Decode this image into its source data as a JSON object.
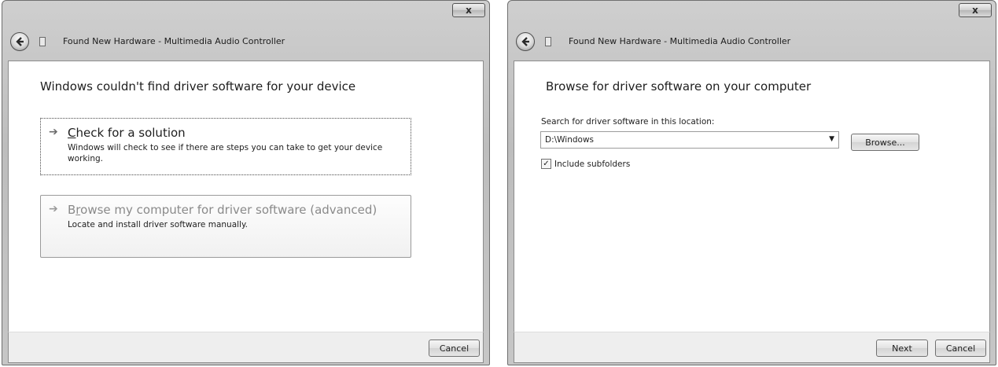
{
  "left_dialog": {
    "close_glyph": "x",
    "title": "Found New Hardware - Multimedia Audio Controller",
    "heading": "Windows couldn't find driver software for your device",
    "options": [
      {
        "title_accel": "C",
        "title_rest": "heck for a solution",
        "description": "Windows will check to see if there are steps you can take to get your device working."
      },
      {
        "title_pre": "B",
        "title_accel": "r",
        "title_rest": "owse my computer for driver software (advanced)",
        "description": "Locate and install driver software manually."
      }
    ],
    "cancel_label": "Cancel"
  },
  "right_dialog": {
    "close_glyph": "x",
    "title": "Found New Hardware - Multimedia Audio Controller",
    "heading": "Browse for driver software on your computer",
    "location_label": "Search for driver software in this location:",
    "location_value": "D:\\Windows",
    "browse_label": "Browse...",
    "include_subfolders_label": "Include subfolders",
    "include_subfolders_checked": true,
    "next_label": "Next",
    "cancel_label": "Cancel"
  },
  "icons": {
    "back": "back-arrow-icon",
    "hardware": "hardware-device-icon",
    "option_arrow": "arrow-right-icon",
    "combo_arrow": "dropdown-arrow-icon"
  }
}
